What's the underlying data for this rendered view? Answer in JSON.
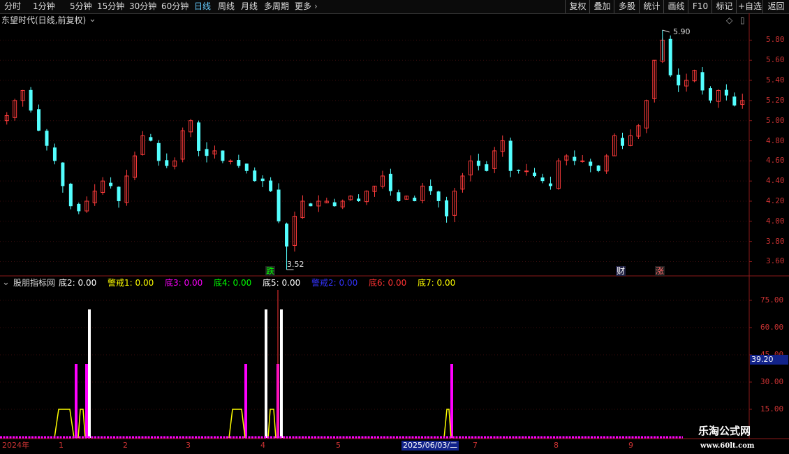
{
  "toolbar": {
    "periods": [
      "分时",
      "1分钟",
      "5分钟",
      "15分钟",
      "30分钟",
      "60分钟",
      "日线",
      "周线",
      "月线",
      "多周期",
      "更多"
    ],
    "active_period": "日线",
    "buttons": [
      "复权",
      "叠加",
      "多股",
      "统计",
      "画线",
      "F10",
      "标记",
      "+自选",
      "返回"
    ]
  },
  "main_panel": {
    "title": "东望时代(日线,前复权)",
    "high_label": "5.90",
    "low_label": "3.52",
    "markers": {
      "die": "跌",
      "cai": "财",
      "zhang": "涨"
    }
  },
  "indicator_panel": {
    "title": "股朋指标网",
    "items": [
      {
        "name": "底2:",
        "value": "0.00",
        "color": "#ffffff"
      },
      {
        "name": "警戒1:",
        "value": "0.00",
        "color": "#ffff00"
      },
      {
        "name": "底3:",
        "value": "0.00",
        "color": "#ff00ff"
      },
      {
        "name": "底4:",
        "value": "0.00",
        "color": "#00ff00"
      },
      {
        "name": "底5:",
        "value": "0.00",
        "color": "#ffffff"
      },
      {
        "name": "警戒2:",
        "value": "0.00",
        "color": "#3333ff"
      },
      {
        "name": "底6:",
        "value": "0.00",
        "color": "#ff3333"
      },
      {
        "name": "底7:",
        "value": "0.00",
        "color": "#ffff00"
      }
    ],
    "current_value": "39.20"
  },
  "x_axis": {
    "labels": [
      "2024年",
      "1",
      "2",
      "3",
      "4",
      "5",
      "2025/06/03/二",
      "7",
      "8",
      "9"
    ]
  },
  "watermark": {
    "line1": "乐淘公式网",
    "line2": "www.60lt.com"
  },
  "chart_data": [
    {
      "type": "candlestick",
      "y_ticks": [
        "5.80",
        "5.60",
        "5.40",
        "5.20",
        "5.00",
        "4.80",
        "4.60",
        "4.40",
        "4.20",
        "4.00",
        "3.80",
        "3.60"
      ],
      "ylim": [
        3.52,
        5.9
      ],
      "high": 5.9,
      "low": 3.52,
      "close_path": [
        5.05,
        5.2,
        5.3,
        5.1,
        4.9,
        4.75,
        4.6,
        4.35,
        4.15,
        4.1,
        4.2,
        4.3,
        4.4,
        4.35,
        4.2,
        4.45,
        4.65,
        4.85,
        4.8,
        4.6,
        4.55,
        4.6,
        4.9,
        5.0,
        4.7,
        4.65,
        4.7,
        4.6,
        4.6,
        4.55,
        4.5,
        4.4,
        4.4,
        4.3,
        4.0,
        3.75,
        4.05,
        4.2,
        4.15,
        4.2,
        4.2,
        4.15,
        4.2,
        4.25,
        4.2,
        4.3,
        4.35,
        4.45,
        4.3,
        4.2,
        4.25,
        4.2,
        4.35,
        4.3,
        4.2,
        4.05,
        4.3,
        4.45,
        4.6,
        4.55,
        4.5,
        4.7,
        4.8,
        4.5,
        4.5,
        4.5,
        4.45,
        4.4,
        4.35,
        4.6,
        4.65,
        4.6,
        4.6,
        4.55,
        4.5,
        4.65,
        4.85,
        4.75,
        4.85,
        4.95,
        5.2,
        5.6,
        5.8,
        5.45,
        5.35,
        5.4,
        5.5,
        5.3,
        5.2,
        5.3,
        5.25,
        5.15,
        5.2
      ]
    },
    {
      "type": "bar",
      "y_ticks": [
        "75.00",
        "60.00",
        "45.00",
        "30.00",
        "15.00"
      ],
      "ylim": [
        0,
        80
      ],
      "series": [
        {
          "name": "底2",
          "color": "#ffffff",
          "bars": [
            {
              "i": 2,
              "v": 70
            },
            {
              "i": 9,
              "v": 70
            },
            {
              "i": 10,
              "v": 70
            }
          ]
        },
        {
          "name": "底3",
          "color": "#ff00ff",
          "bars": [
            {
              "i": 0,
              "v": 40
            },
            {
              "i": 1,
              "v": 40
            },
            {
              "i": 7,
              "v": 40
            },
            {
              "i": 9,
              "v": 40
            },
            {
              "i": 13,
              "v": 40
            }
          ]
        },
        {
          "name": "底6",
          "color": "#ff3333",
          "bars": [
            {
              "i": 9,
              "v": 80
            }
          ]
        },
        {
          "name": "警戒1",
          "color": "#ffff00",
          "plateaus": [
            {
              "v": 15
            },
            {
              "v": 15
            },
            {
              "v": 15
            },
            {
              "v": 15
            },
            {
              "v": 15
            }
          ]
        }
      ]
    }
  ]
}
